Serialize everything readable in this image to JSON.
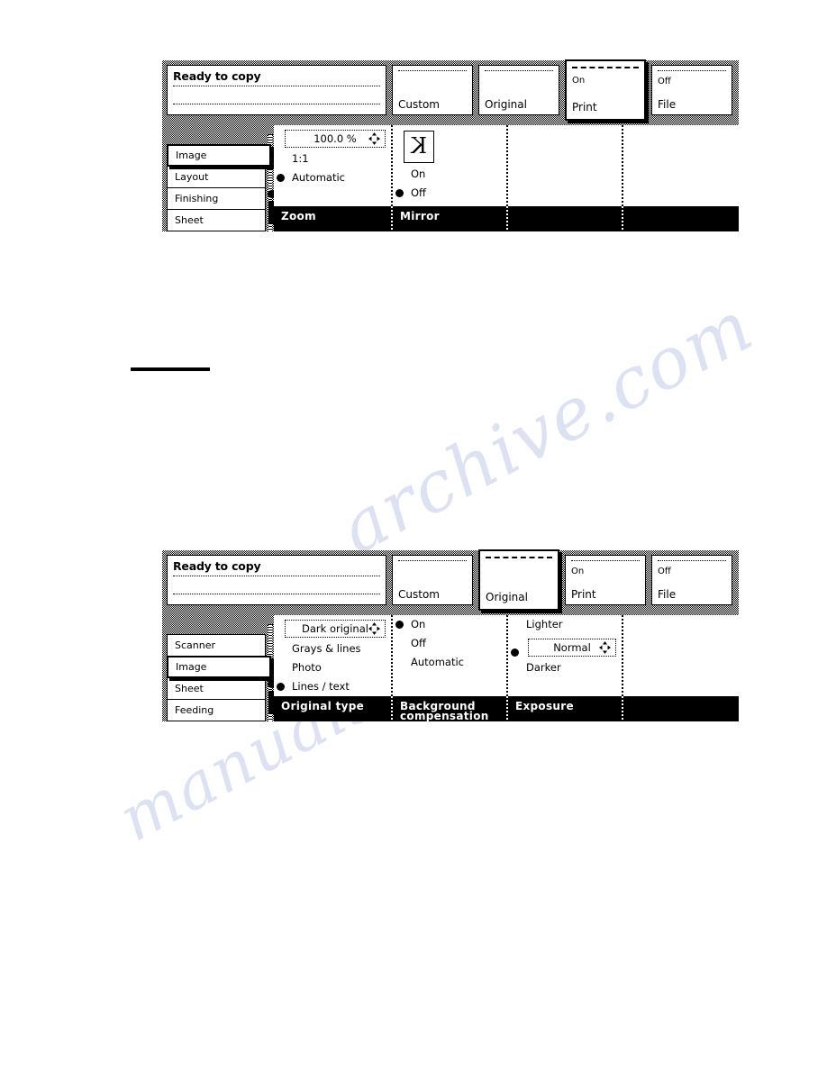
{
  "watermark": {
    "line1": "archive.com",
    "line2": "manuals"
  },
  "panels": [
    {
      "name": "image-zoom-panel",
      "status": {
        "title": "Ready to copy"
      },
      "tabs": [
        {
          "name": "custom",
          "label": "Custom",
          "sub": "",
          "selected": false
        },
        {
          "name": "original",
          "label": "Original",
          "sub": "",
          "selected": false
        },
        {
          "name": "print",
          "label": "Print",
          "sub": "On",
          "selected": true
        },
        {
          "name": "file",
          "label": "File",
          "sub": "Off",
          "selected": false
        }
      ],
      "sidebar": [
        {
          "name": "image",
          "label": "Image",
          "selected": true
        },
        {
          "name": "layout",
          "label": "Layout",
          "selected": false
        },
        {
          "name": "finishing",
          "label": "Finishing",
          "selected": false
        },
        {
          "name": "sheet",
          "label": "Sheet",
          "selected": false
        }
      ],
      "columns": [
        {
          "name": "zoom",
          "title": "Zoom",
          "spin": {
            "value": "100.0 %",
            "indented": false
          },
          "options": [
            {
              "label": "1:1",
              "selected": false
            },
            {
              "label": "Automatic",
              "selected": true
            }
          ]
        },
        {
          "name": "mirror",
          "title": "Mirror",
          "icon": "K",
          "options": [
            {
              "label": "On",
              "selected": false
            },
            {
              "label": "Off",
              "selected": true
            }
          ]
        },
        {
          "name": "empty-1",
          "title": "",
          "options": []
        },
        {
          "name": "empty-2",
          "title": "",
          "options": []
        }
      ]
    },
    {
      "name": "original-type-panel",
      "status": {
        "title": "Ready to copy"
      },
      "tabs": [
        {
          "name": "custom",
          "label": "Custom",
          "sub": "",
          "selected": false
        },
        {
          "name": "original",
          "label": "Original",
          "sub": "",
          "selected": true
        },
        {
          "name": "print",
          "label": "Print",
          "sub": "On",
          "selected": false
        },
        {
          "name": "file",
          "label": "File",
          "sub": "Off",
          "selected": false
        }
      ],
      "sidebar": [
        {
          "name": "scanner",
          "label": "Scanner",
          "selected": false
        },
        {
          "name": "image",
          "label": "Image",
          "selected": true
        },
        {
          "name": "sheet",
          "label": "Sheet",
          "selected": false
        },
        {
          "name": "feeding",
          "label": "Feeding",
          "selected": false
        }
      ],
      "columns": [
        {
          "name": "original-type",
          "title": "Original type",
          "spin": {
            "value": "Dark original",
            "indented": false
          },
          "options": [
            {
              "label": "Grays & lines",
              "selected": false
            },
            {
              "label": "Photo",
              "selected": false
            },
            {
              "label": "Lines / text",
              "selected": true
            }
          ]
        },
        {
          "name": "background-compensation",
          "title": "Background compensation",
          "options": [
            {
              "label": "On",
              "selected": true
            },
            {
              "label": "Off",
              "selected": false
            },
            {
              "label": "Automatic",
              "selected": false
            }
          ]
        },
        {
          "name": "exposure",
          "title": "Exposure",
          "options": [
            {
              "label": "Lighter",
              "selected": false
            }
          ],
          "spin2": {
            "value": "Normal",
            "selected": true
          },
          "options_after": [
            {
              "label": "Darker",
              "selected": false
            }
          ]
        },
        {
          "name": "empty-1",
          "title": "",
          "options": []
        }
      ]
    }
  ]
}
